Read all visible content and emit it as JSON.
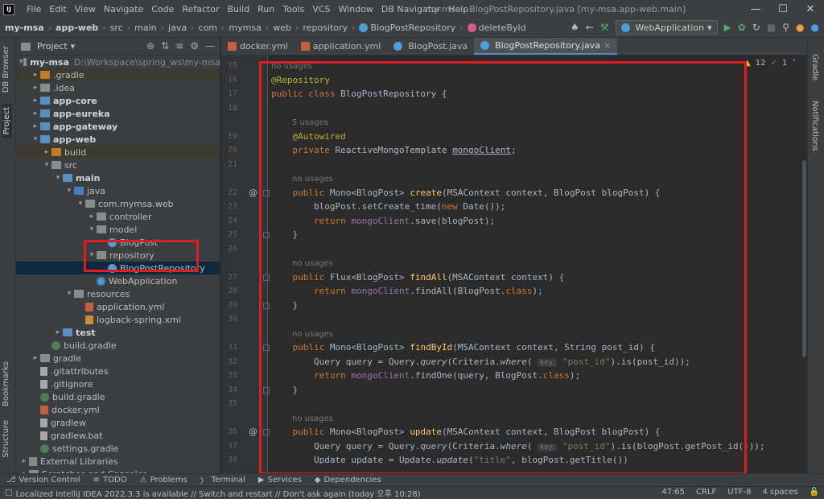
{
  "colors": {
    "accent_red": "#e11b22",
    "selection": "#0d293e",
    "tab_underline": "#4a88c7"
  },
  "menu": {
    "logo": "IJ",
    "items": [
      "File",
      "Edit",
      "View",
      "Navigate",
      "Code",
      "Refactor",
      "Build",
      "Run",
      "Tools",
      "VCS",
      "Window",
      "DB Navigator",
      "Help"
    ],
    "window_title": "my-msa - BlogPostRepository.java [my-msa.app-web.main]"
  },
  "breadcrumb": [
    "my-msa",
    "app-web",
    "src",
    "main",
    "java",
    "com",
    "mymsa",
    "web",
    "repository",
    "BlogPostRepository",
    "deleteById"
  ],
  "toolbar": {
    "run_config": "WebApplication"
  },
  "side_left": {
    "project": "Project",
    "db_browser": "DB Browser",
    "bookmarks": "Bookmarks",
    "structure": "Structure"
  },
  "side_right": {
    "gradle": "Gradle",
    "notifications": "Notifications"
  },
  "project_panel": {
    "title": "Project"
  },
  "tree": [
    {
      "label": "my-msa",
      "path": "D:\\Workspace\\spring_ws\\my-msa",
      "bold": true,
      "indent": 0,
      "arrow": "v",
      "icon": "grey"
    },
    {
      "label": ".gradle",
      "indent": 1,
      "arrow": ">",
      "icon": "orange",
      "hl": true
    },
    {
      "label": ".idea",
      "indent": 1,
      "arrow": ">",
      "icon": "grey"
    },
    {
      "label": "app-core",
      "indent": 1,
      "arrow": ">",
      "icon": "blue",
      "bold": true
    },
    {
      "label": "app-eureka",
      "indent": 1,
      "arrow": ">",
      "icon": "blue",
      "bold": true
    },
    {
      "label": "app-gateway",
      "indent": 1,
      "arrow": ">",
      "icon": "blue",
      "bold": true
    },
    {
      "label": "app-web",
      "indent": 1,
      "arrow": "v",
      "icon": "blue",
      "bold": true
    },
    {
      "label": "build",
      "indent": 2,
      "arrow": ">",
      "icon": "orange",
      "hl": true
    },
    {
      "label": "src",
      "indent": 2,
      "arrow": "v",
      "icon": "grey"
    },
    {
      "label": "main",
      "indent": 3,
      "arrow": "v",
      "icon": "blue",
      "bold": true
    },
    {
      "label": "java",
      "indent": 4,
      "arrow": "v",
      "icon": "src"
    },
    {
      "label": "com.mymsa.web",
      "indent": 5,
      "arrow": "v",
      "icon": "grey"
    },
    {
      "label": "controller",
      "indent": 6,
      "arrow": ">",
      "icon": "grey"
    },
    {
      "label": "model",
      "indent": 6,
      "arrow": "v",
      "icon": "grey"
    },
    {
      "label": "BlogPost",
      "indent": 7,
      "arrow": "",
      "icon": "cls"
    },
    {
      "label": "repository",
      "indent": 6,
      "arrow": "v",
      "icon": "grey"
    },
    {
      "label": "BlogPostRepository",
      "indent": 7,
      "arrow": "",
      "icon": "cls",
      "sel": true
    },
    {
      "label": "WebApplication",
      "indent": 6,
      "arrow": "",
      "icon": "app"
    },
    {
      "label": "resources",
      "indent": 4,
      "arrow": "v",
      "icon": "grey"
    },
    {
      "label": "application.yml",
      "indent": 5,
      "arrow": "",
      "icon": "yml"
    },
    {
      "label": "logback-spring.xml",
      "indent": 5,
      "arrow": "",
      "icon": "xml"
    },
    {
      "label": "test",
      "indent": 3,
      "arrow": ">",
      "icon": "blue",
      "bold": true
    },
    {
      "label": "build.gradle",
      "indent": 2,
      "arrow": "",
      "icon": "gr"
    },
    {
      "label": "gradle",
      "indent": 1,
      "arrow": ">",
      "icon": "grey"
    },
    {
      "label": ".gitattributes",
      "indent": 1,
      "arrow": "",
      "icon": "file"
    },
    {
      "label": ".gitignore",
      "indent": 1,
      "arrow": "",
      "icon": "file"
    },
    {
      "label": "build.gradle",
      "indent": 1,
      "arrow": "",
      "icon": "gr"
    },
    {
      "label": "docker.yml",
      "indent": 1,
      "arrow": "",
      "icon": "yml"
    },
    {
      "label": "gradlew",
      "indent": 1,
      "arrow": "",
      "icon": "file"
    },
    {
      "label": "gradlew.bat",
      "indent": 1,
      "arrow": "",
      "icon": "file"
    },
    {
      "label": "settings.gradle",
      "indent": 1,
      "arrow": "",
      "icon": "gr"
    },
    {
      "label": "External Libraries",
      "indent": 0,
      "arrow": ">",
      "icon": "lib"
    },
    {
      "label": "Scratches and Consoles",
      "indent": 0,
      "arrow": ">",
      "icon": "grey"
    }
  ],
  "editor_tabs": [
    {
      "label": "docker.yml",
      "icon": "yml"
    },
    {
      "label": "application.yml",
      "icon": "yml"
    },
    {
      "label": "BlogPost.java",
      "icon": "cls"
    },
    {
      "label": "BlogPostRepository.java",
      "icon": "cls",
      "active": true
    }
  ],
  "inspections": {
    "warnings": "12",
    "ok": "1"
  },
  "code_lines": [
    {
      "n": "15",
      "hint": "no usages"
    },
    {
      "n": "16",
      "html": "<span class='an'>@Repository</span>"
    },
    {
      "n": "17",
      "html": "<span class='kw'>public class </span>BlogPostRepository {"
    },
    {
      "n": "18",
      "html": ""
    },
    {
      "hint": "5 usages",
      "ind": 1
    },
    {
      "n": "19",
      "html": "    <span class='an'>@Autowired</span>"
    },
    {
      "n": "20",
      "html": "    <span class='kw'>private </span>ReactiveMongoTemplate <span class='ul fd'>mongoClient</span>;"
    },
    {
      "n": "21",
      "html": ""
    },
    {
      "hint": "no usages",
      "ind": 1
    },
    {
      "n": "22",
      "at": true,
      "fold": true,
      "html": "    <span class='kw'>public </span>Mono&lt;BlogPost&gt; <span style='color:#ffc66d'>create</span>(MSAContext context, BlogPost blogPost) {"
    },
    {
      "n": "23",
      "html": "        blogPost.setCreate_time(<span class='kw'>new </span>Date());"
    },
    {
      "n": "24",
      "html": "        <span class='kw'>return </span><span class='fd'>mongoClient</span>.save(blogPost);"
    },
    {
      "n": "25",
      "fold": true,
      "html": "    }"
    },
    {
      "n": "26",
      "html": ""
    },
    {
      "hint": "no usages",
      "ind": 1
    },
    {
      "n": "27",
      "fold": true,
      "html": "    <span class='kw'>public </span>Flux&lt;BlogPost&gt; <span style='color:#ffc66d'>findAll</span>(MSAContext context) {"
    },
    {
      "n": "28",
      "html": "        <span class='kw'>return </span><span class='fd'>mongoClient</span>.findAll(BlogPost.<span class='kw'>class</span>);"
    },
    {
      "n": "29",
      "fold": true,
      "html": "    }"
    },
    {
      "n": "30",
      "html": ""
    },
    {
      "hint": "no usages",
      "ind": 1
    },
    {
      "n": "31",
      "fold": true,
      "html": "    <span class='kw'>public </span>Mono&lt;BlogPost&gt; <span style='color:#ffc66d'>findById</span>(MSAContext context, String post_id) {"
    },
    {
      "n": "32",
      "html": "        Query query = Query.<span class='it'>query</span>(Criteria.<span class='it'>where</span>( <span class='ph'>key:</span> <span class='st'>\"post_id\"</span>).is(post_id));"
    },
    {
      "n": "33",
      "html": "        <span class='kw'>return </span><span class='fd'>mongoClient</span>.findOne(query, BlogPost.<span class='kw'>class</span>);"
    },
    {
      "n": "34",
      "fold": true,
      "html": "    }"
    },
    {
      "n": "35",
      "html": ""
    },
    {
      "hint": "no usages",
      "ind": 1
    },
    {
      "n": "36",
      "at": true,
      "fold": true,
      "html": "    <span class='kw'>public </span>Mono&lt;BlogPost&gt; <span style='color:#ffc66d'>update</span>(MSAContext context, BlogPost blogPost) {"
    },
    {
      "n": "37",
      "html": "        Query query = Query.<span class='it'>query</span>(Criteria.<span class='it'>where</span>( <span class='ph'>key:</span> <span class='st'>\"post_id\"</span>).is(blogPost.getPost_id()));"
    },
    {
      "n": "38",
      "html": "        Update update = Update.<span class='it'>update</span>(<span class='st'>\"title\"</span>, blogPost.getTitle())"
    }
  ],
  "bottom_tabs": [
    "Version Control",
    "TODO",
    "Problems",
    "Terminal",
    "Services",
    "Dependencies"
  ],
  "status": {
    "message": "Localized IntelliJ IDEA 2022.3.3 is available // Switch and restart // Don't ask again (today 오후 10:28)",
    "position": "47:65",
    "line_sep": "CRLF",
    "encoding": "UTF-8",
    "indent": "4 spaces"
  }
}
